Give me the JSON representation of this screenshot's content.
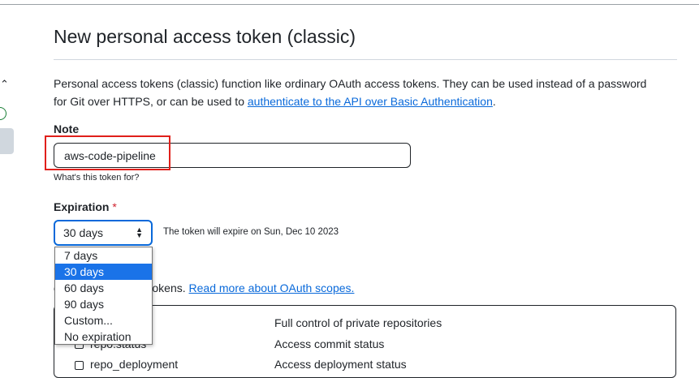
{
  "title": "New personal access token (classic)",
  "description": {
    "text": "Personal access tokens (classic) function like ordinary OAuth access tokens. They can be used instead of a password for Git over HTTPS, or can be used to ",
    "link": "authenticate to the API over Basic Authentication",
    "end": "."
  },
  "note": {
    "label": "Note",
    "value": "aws-code-pipeline",
    "hint": "What's this token for?"
  },
  "expiration": {
    "label": "Expiration",
    "required_mark": "*",
    "selected": "30 days",
    "note": "The token will expire on Sun, Dec 10 2023",
    "options": [
      "7 days",
      "30 days",
      "60 days",
      "90 days",
      "Custom...",
      "No expiration"
    ]
  },
  "scopes": {
    "text": "ccess for personal tokens. ",
    "link": "Read more about OAuth scopes.",
    "rows": [
      {
        "name": "",
        "desc": "Full control of private repositories"
      },
      {
        "name": "repo:status",
        "desc": "Access commit status"
      },
      {
        "name": "repo_deployment",
        "desc": "Access deployment status"
      }
    ]
  },
  "colors": {
    "accent": "#0969da",
    "selected_option": "#1a73e8",
    "highlight": "#e0201b"
  }
}
